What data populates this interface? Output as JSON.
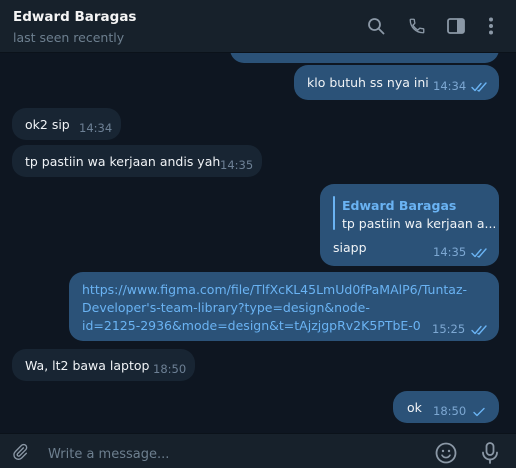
{
  "header": {
    "contact_name": "Edward Baragas",
    "status": "last seen recently",
    "icons": [
      "search-icon",
      "phone-icon",
      "sidebar-toggle-icon",
      "more-vert-icon"
    ]
  },
  "messages": [
    {
      "direction": "out",
      "text": "klo butuh ss nya ini",
      "time": "14:34",
      "read": true
    },
    {
      "direction": "in",
      "text": "ok2 sip",
      "time": "14:34"
    },
    {
      "direction": "in",
      "text": "tp pastiin wa kerjaan andis yah",
      "time": "14:35"
    },
    {
      "direction": "out",
      "reply_to": {
        "name": "Edward Baragas",
        "text": "tp pastiin wa kerjaan a..."
      },
      "text": "siapp",
      "time": "14:35",
      "read": true
    },
    {
      "direction": "out",
      "link_lines": [
        "https://www.figma.com/file/TlfXcKL45LmUd0fPaMAlP6/Tuntaz-",
        "Developer's-team-library?type=design&node-",
        "id=2125-2936&mode=design&t=tAjzjgpRv2K5PTbE-0"
      ],
      "time": "15:25",
      "read": true
    },
    {
      "direction": "in",
      "text": "Wa, lt2 bawa laptop",
      "time": "18:50"
    },
    {
      "direction": "out",
      "text": "ok",
      "time": "18:50",
      "read": false
    }
  ],
  "composer": {
    "placeholder": "Write a message...",
    "icons": [
      "attach-icon",
      "emoji-icon",
      "microphone-icon"
    ]
  },
  "colors": {
    "background": "#0e1621",
    "panel": "#17212b",
    "incoming_bubble": "#182533",
    "outgoing_bubble": "#2b5278",
    "accent": "#6ab3f3"
  }
}
